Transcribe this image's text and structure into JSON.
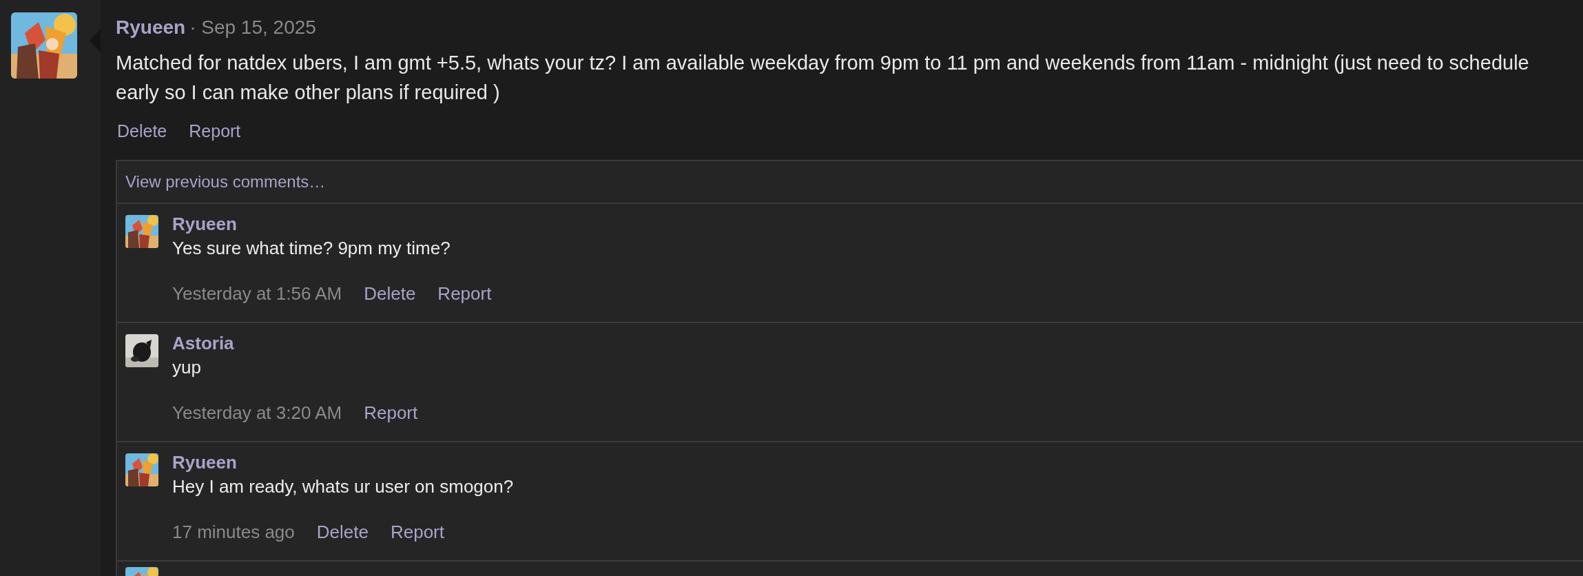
{
  "post": {
    "author": "Ryueen",
    "separator": "·",
    "date": "Sep 15, 2025",
    "body": "Matched for natdex ubers, I am gmt +5.5, whats your tz? I am available weekday from 9pm to 11 pm and weekends from 11am - midnight (just need to schedule early so I can make other plans if required )",
    "avatar": {
      "kind": "picture"
    },
    "actions": [
      "Delete",
      "Report"
    ]
  },
  "comments": {
    "view_previous": "View previous comments…",
    "items": [
      {
        "author": "Ryueen",
        "avatar": {
          "kind": "picture"
        },
        "text": "Yes sure what time? 9pm my time?",
        "time": "Yesterday at 1:56 AM",
        "actions": [
          "Delete",
          "Report"
        ]
      },
      {
        "author": "Astoria",
        "avatar": {
          "kind": "picture"
        },
        "text": "yup",
        "time": "Yesterday at 3:20 AM",
        "actions": [
          "Report"
        ]
      },
      {
        "author": "Ryueen",
        "avatar": {
          "kind": "picture"
        },
        "text": "Hey I am ready, whats ur user on smogon?",
        "time": "17 minutes ago",
        "actions": [
          "Delete",
          "Report"
        ]
      }
    ],
    "next_avatar": {
      "kind": "picture"
    }
  }
}
